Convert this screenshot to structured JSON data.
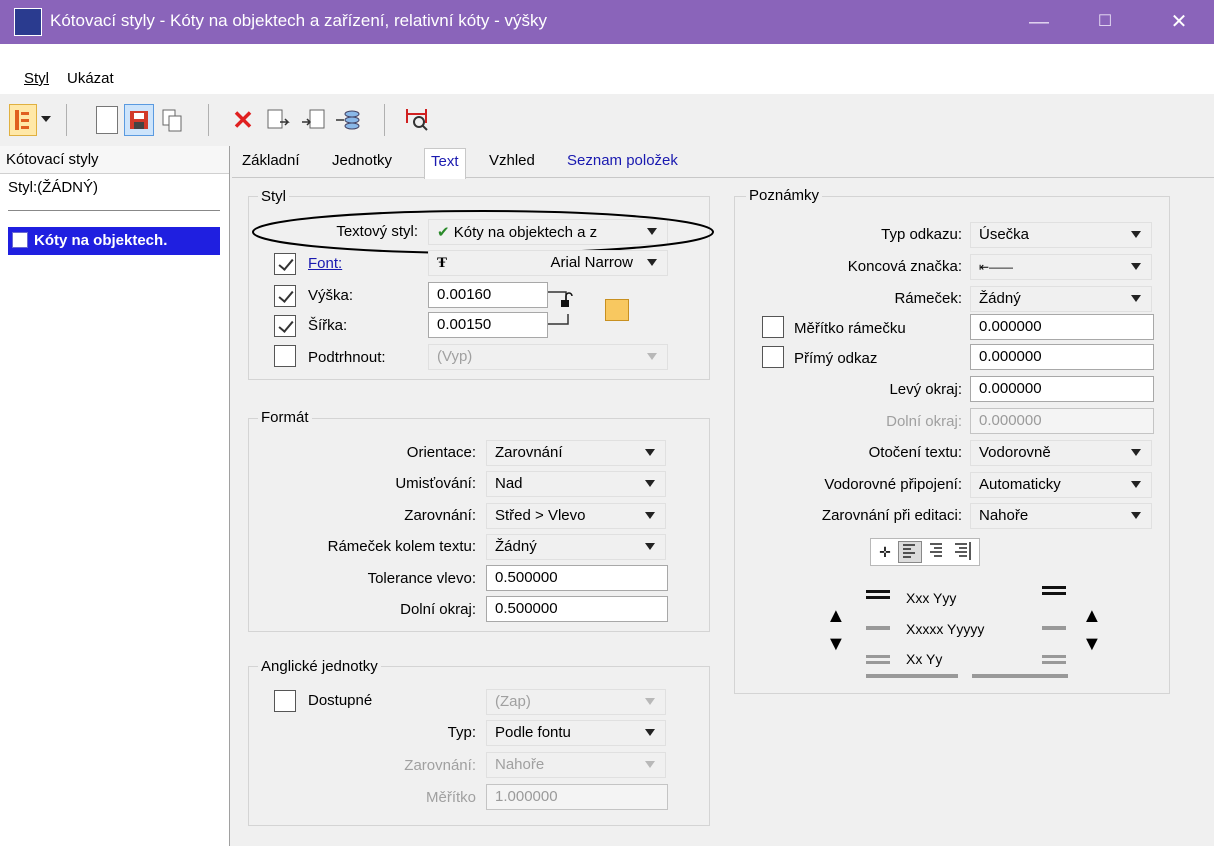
{
  "window": {
    "title": "Kótovací styly -  Kóty na objektech a zařízení, relativní kóty - výšky",
    "minimize": "—",
    "maximize": "☐",
    "close": "✕"
  },
  "menu": [
    "Styl",
    "Ukázat"
  ],
  "toolbar": {
    "icons": [
      "tree-view-icon",
      "new-style-icon",
      "save-icon",
      "copy-style-icon",
      "delete-icon",
      "import-icon",
      "export-icon",
      "update-icon",
      "match-dimension-icon"
    ]
  },
  "left": {
    "header": "Kótovací styly",
    "style_label": "Styl:(ŽÁDNÝ)",
    "selected_item": "Kóty na objektech."
  },
  "tabs": [
    "Základní",
    "Jednotky",
    "Text",
    "Vzhled",
    "Seznam položek"
  ],
  "active_tab": "Text",
  "styl": {
    "title": "Styl",
    "text_style_label": "Textový styl:",
    "text_style_value": "Kóty na objektech a z",
    "font_label": "Font:",
    "font_value": "Arial Narrow",
    "font_checked": true,
    "height_label": "Výška:",
    "height_value": "0.00160",
    "height_checked": true,
    "width_label": "Šířka:",
    "width_value": "0.00150",
    "width_checked": true,
    "underline_label": "Podtrhnout:",
    "underline_value": "(Vyp)",
    "underline_checked": false
  },
  "format": {
    "title": "Formát",
    "orientation_label": "Orientace:",
    "orientation_value": "Zarovnání",
    "placement_label": "Umisťování:",
    "placement_value": "Nad",
    "justification_label": "Zarovnání:",
    "justification_value": "Střed > Vlevo",
    "frame_label": "Rámeček kolem textu:",
    "frame_value": "Žádný",
    "tol_left_label": "Tolerance vlevo:",
    "tol_left_value": "0.500000",
    "bottom_margin_label": "Dolní okraj:",
    "bottom_margin_value": "0.500000"
  },
  "english": {
    "title": "Anglické jednotky",
    "available_label": "Dostupné",
    "available_checked": false,
    "available_value": "(Zap)",
    "type_label": "Typ:",
    "type_value": "Podle fontu",
    "justification_label": "Zarovnání:",
    "justification_value": "Nahoře",
    "scale_label": "Měřítko",
    "scale_value": "1.000000"
  },
  "notes": {
    "title": "Poznámky",
    "leader_type_label": "Typ odkazu:",
    "leader_type_value": "Úsečka",
    "terminator_label": "Koncová značka:",
    "terminator_value": "⇤——",
    "frame_label": "Rámeček:",
    "frame_value": "Žádný",
    "frame_scale_label": "Měřítko rámečku",
    "frame_scale_value": "0.000000",
    "frame_scale_checked": false,
    "inline_leader_label": "Přímý odkaz",
    "inline_leader_value": "0.000000",
    "inline_leader_checked": false,
    "left_margin_label": "Levý okraj:",
    "left_margin_value": "0.000000",
    "bottom_margin_label": "Dolní okraj:",
    "bottom_margin_value": "0.000000",
    "text_rotation_label": "Otočení textu:",
    "text_rotation_value": "Vodorovně",
    "horiz_attach_label": "Vodorovné připojení:",
    "horiz_attach_value": "Automaticky",
    "edit_just_label": "Zarovnání při editaci:",
    "edit_just_value": "Nahoře",
    "preview_lines": [
      "Xxx Yyy",
      "Xxxxx Yyyyy",
      "Xx Yy"
    ]
  }
}
